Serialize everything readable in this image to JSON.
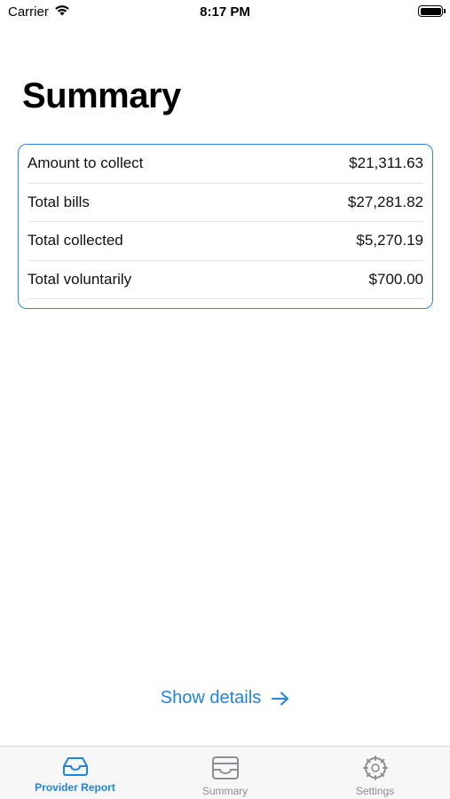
{
  "status_bar": {
    "carrier": "Carrier",
    "time": "8:17 PM"
  },
  "title": "Summary",
  "summary_rows": [
    {
      "label": "Amount to collect",
      "value": "$21,311.63"
    },
    {
      "label": "Total bills",
      "value": "$27,281.82"
    },
    {
      "label": "Total collected",
      "value": "$5,270.19"
    },
    {
      "label": "Total voluntarily",
      "value": "$700.00"
    }
  ],
  "show_details_label": "Show details",
  "tabs": [
    {
      "label": "Provider Report",
      "icon": "tray-icon",
      "active": true
    },
    {
      "label": "Summary",
      "icon": "archive-box-icon",
      "active": false
    },
    {
      "label": "Settings",
      "icon": "gear-icon",
      "active": false
    }
  ],
  "colors": {
    "accent": "#1f83e0",
    "card_border": "#2c86e6",
    "inactive_tab": "#8e8e93"
  }
}
